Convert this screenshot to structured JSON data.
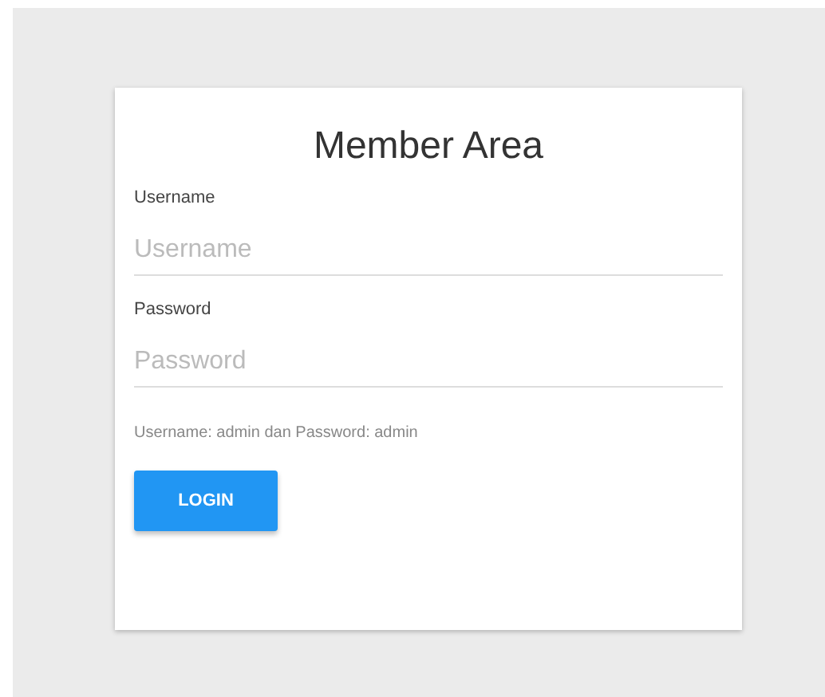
{
  "card": {
    "title": "Member Area",
    "fields": [
      {
        "label": "Username",
        "placeholder": "Username"
      },
      {
        "label": "Password",
        "placeholder": "Password"
      }
    ],
    "hint": "Username: admin dan Password: admin",
    "button": "LOGIN"
  }
}
